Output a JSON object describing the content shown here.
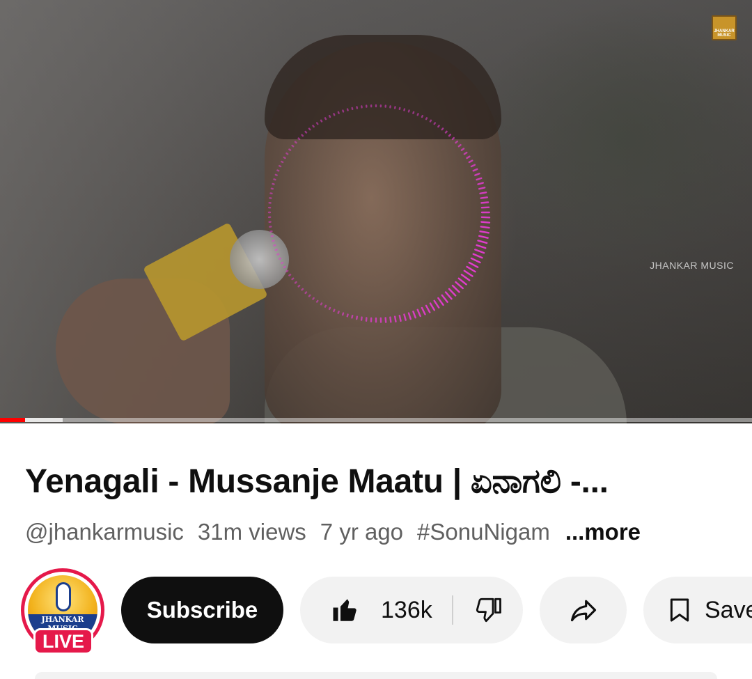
{
  "video": {
    "watermark": "JHANKAR MUSIC",
    "logo_text": "JHANKAR MUSIC",
    "progress_played_fraction": 0.033,
    "progress_buffered_fraction": 0.083,
    "colors": {
      "progress": "#ff0000",
      "visualizer": "#e23ccf"
    }
  },
  "details": {
    "title": "Yenagali - Mussanje Maatu | ಏನಾಗಲಿ -...",
    "channel_handle": "@jhankarmusic",
    "views": "31m views",
    "age": "7 yr ago",
    "hashtag": "#SonuNigam",
    "more_label": "...more"
  },
  "actions": {
    "avatar_brand": "JHANKAR MUSIC",
    "live_badge": "LIVE",
    "subscribe_label": "Subscribe",
    "like_count": "136k",
    "save_label": "Save",
    "icons": {
      "like": "thumbs-up-icon",
      "dislike": "thumbs-down-icon",
      "share": "share-arrow-icon",
      "save": "bookmark-icon"
    },
    "colors": {
      "subscribe_bg": "#0f0f0f",
      "live": "#e5194a",
      "pill_bg": "#f2f2f2"
    }
  }
}
